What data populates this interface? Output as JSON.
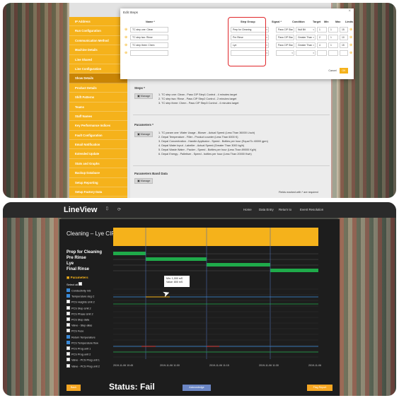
{
  "panel1": {
    "sidebar_items": [
      "IP Address",
      "Run Configuration",
      "Communication Method",
      "Machine Details",
      "Line Shared",
      "Line Configuration",
      "Show Details",
      "Product Details",
      "Shift Patterns",
      "Teams",
      "Staff Names",
      "Key Performance Indices",
      "Fault Configuration",
      "Email Notification",
      "Extended Update",
      "Stats and Graphs",
      "Backup Database",
      "Setup Reporting",
      "Setup Factory Data"
    ],
    "active_index": 6,
    "modal": {
      "title": "Edit Steps",
      "headers": [
        "Name *",
        "Step Group",
        "Signal *",
        "Condition",
        "Target",
        "Min",
        "Max",
        "Limits"
      ],
      "rows": [
        [
          "TC step one: Clean",
          "Prep for Cleaning",
          "Pass CIP Sta",
          "Null Bit",
          "1",
          "1",
          "15"
        ],
        [
          "TC step two: Rinse",
          "Pre Rinse",
          "Pass CIP Sta",
          "Greater Than",
          "2",
          "1",
          "10"
        ],
        [
          "TC step three: Chem",
          "Lye",
          "Pass CIP Sta",
          "Greater Than",
          "4",
          "1",
          "15"
        ],
        [
          "",
          "",
          "",
          "",
          "",
          "",
          ""
        ]
      ],
      "cancel_label": "Cancel",
      "ok_label": "OK"
    },
    "steps_title": "Steps *",
    "manage_label": "Manage",
    "steps": [
      "1. TC step one: Clean - Pass CIP Step1 Control - 4 minutes target",
      "2. TC step two: Rinse - Pass CIP Step2 Control - 2 minutes target",
      "3. TC step three: Chem - Pass CIP Step3 Control - 4 minutes target"
    ],
    "params_title": "Parameters *",
    "params": [
      "1. TC param one: Water Usage - Blower - Actual Speed (Less Than 36000 L/sch)",
      "2. Depal Temperature - Filler - Product counter (Less Than 6000 K)",
      "3. Depal Concentration - Handle Applicator - Speed - Bottles per hour (Equal To 40000 gpm)",
      "4. Depal Water Input - Labeller - Actual Speed (Greater Than 3000 kg/h)",
      "5. Depal Waste Water - Packer - Speed - Bottles per hour (Less Than 89000 Kg/h)",
      "6. Depal Energy - Palletiser - Speed - bottles per hour (Less Than 20000 Kwh)"
    ],
    "params_band_title": "Parameters Band Data",
    "required_note": "Fields marked with * are required"
  },
  "panel2": {
    "logo": "LineView",
    "nav_links": [
      "Home",
      "Data Entry",
      "Return to",
      "Event Resolution"
    ],
    "chart_title": "Cleaning – Lye CIP",
    "steps": [
      "Prep for Cleaning",
      "Pre Rinse",
      "Lye",
      "Final Rinse"
    ],
    "parameters_label": "Parameters",
    "select_all": "Select all",
    "param_list": [
      {
        "name": "Conductivity mS",
        "checked": true
      },
      {
        "name": "Temperature deg C",
        "checked": true
      },
      {
        "name": "PCS Heights Unit 2",
        "checked": false
      },
      {
        "name": "PCS Step Unit 2",
        "checked": false
      },
      {
        "name": "PCS Phase Unit 2",
        "checked": false
      },
      {
        "name": "PCS Step data",
        "checked": false
      },
      {
        "name": "Valve - Step alias",
        "checked": false
      },
      {
        "name": "PCS Fuse",
        "checked": false
      },
      {
        "name": "Return Temperature",
        "checked": true
      },
      {
        "name": "PCS Temperature flow",
        "checked": true
      },
      {
        "name": "PCS Prog unit 1",
        "checked": false
      },
      {
        "name": "PCS Prog unit 2",
        "checked": false
      },
      {
        "name": "Valve - PCS Prog unit 1",
        "checked": false
      },
      {
        "name": "Valve - PCS Prog unit 2",
        "checked": false
      }
    ],
    "tooltip": {
      "line1": "Min: 1,000 mS",
      "line2": "Value: 800 mS"
    },
    "x_ticks": [
      "2019-11-06 10:45",
      "2019-11-06 11:00",
      "2019-11-06 11:15",
      "2019-11-06 11:30",
      "2019-11-06"
    ],
    "back_label": "Back",
    "status": "Status: Fail",
    "ack_label": "Acknowledge",
    "flag_label": "Flag Report",
    "colors": {
      "accent": "#f5b21b",
      "step_bar": "#1faa4a",
      "trace_green": "#1faa4a",
      "trace_blue": "#3d8fe0",
      "trace_red": "#d23a3a"
    }
  }
}
